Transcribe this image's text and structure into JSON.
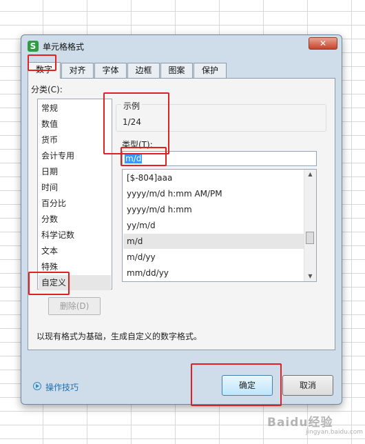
{
  "dialog": {
    "title": "单元格格式",
    "app_icon_letter": "S",
    "tabs": [
      "数字",
      "对齐",
      "字体",
      "边框",
      "图案",
      "保护"
    ],
    "category_label": "分类(C):",
    "categories": [
      "常规",
      "数值",
      "货币",
      "会计专用",
      "日期",
      "时间",
      "百分比",
      "分数",
      "科学记数",
      "文本",
      "特殊",
      "自定义"
    ],
    "selected_category": "自定义",
    "sample_title": "示例",
    "sample_value": "1/24",
    "type_label": "类型(T):",
    "type_value": "m/d",
    "formats": [
      "[$-804]aaa",
      "yyyy/m/d h:mm AM/PM",
      "yyyy/m/d h:mm",
      "yy/m/d",
      "m/d",
      "m/d/yy",
      "mm/dd/yy"
    ],
    "selected_format": "m/d",
    "delete_label": "删除(D)",
    "description": "以现有格式为基础，生成自定义的数字格式。",
    "tips_label": "操作技巧",
    "ok_label": "确定",
    "cancel_label": "取消"
  },
  "watermark": {
    "text": "Baidu经验",
    "sub": "jingyan.baidu.com"
  },
  "colors": {
    "highlight_red": "#e02020",
    "selection_blue": "#3399ff",
    "link_blue": "#1f6fb2"
  }
}
